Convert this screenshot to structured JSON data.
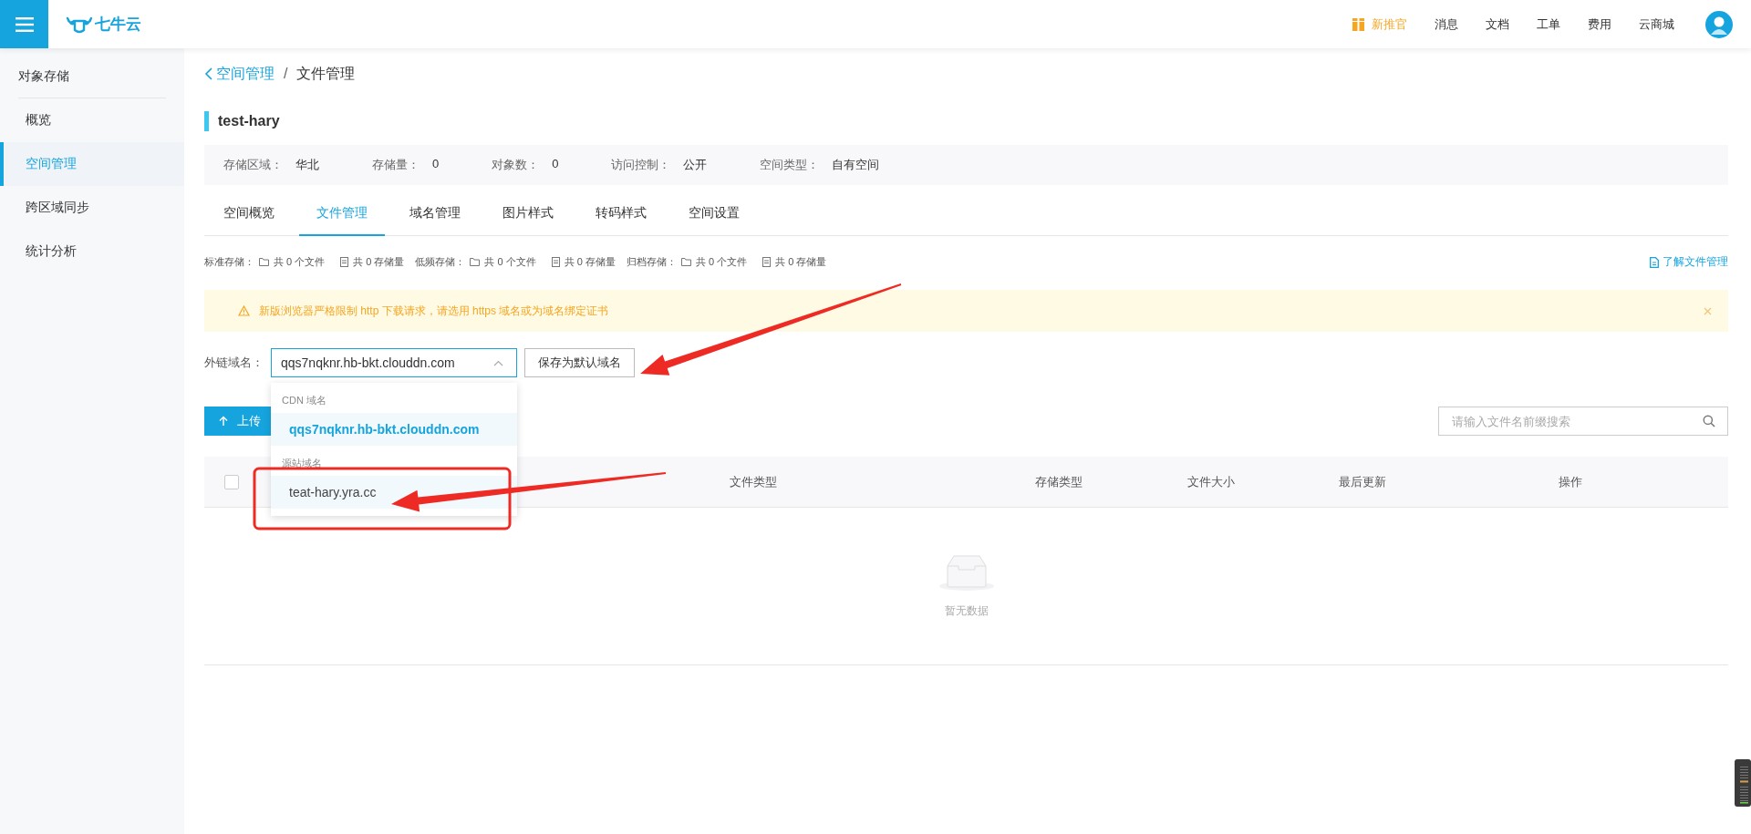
{
  "header": {
    "logo": "七牛云",
    "nav": [
      {
        "label": "新推官",
        "kind": "promo"
      },
      {
        "label": "消息",
        "kind": "link"
      },
      {
        "label": "文档",
        "kind": "link"
      },
      {
        "label": "工单",
        "kind": "link"
      },
      {
        "label": "费用",
        "kind": "link"
      },
      {
        "label": "云商城",
        "kind": "link"
      }
    ]
  },
  "sidebar": {
    "title": "对象存储",
    "items": [
      {
        "label": "概览",
        "selected": false
      },
      {
        "label": "空间管理",
        "selected": true
      },
      {
        "label": "跨区域同步",
        "selected": false
      },
      {
        "label": "统计分析",
        "selected": false
      }
    ]
  },
  "breadcrumb": {
    "back": "空间管理",
    "separator": "/",
    "current": "文件管理"
  },
  "bucket": {
    "title": "test-hary",
    "info": [
      {
        "label": "存储区域：",
        "value": "华北"
      },
      {
        "label": "存储量：",
        "value": "0"
      },
      {
        "label": "对象数：",
        "value": "0"
      },
      {
        "label": "访问控制：",
        "value": "公开"
      },
      {
        "label": "空间类型：",
        "value": "自有空间"
      }
    ]
  },
  "tabs": [
    {
      "label": "空间概览",
      "selected": false
    },
    {
      "label": "文件管理",
      "selected": true
    },
    {
      "label": "域名管理",
      "selected": false
    },
    {
      "label": "图片样式",
      "selected": false
    },
    {
      "label": "转码样式",
      "selected": false
    },
    {
      "label": "空间设置",
      "selected": false
    }
  ],
  "stats": {
    "groups": [
      {
        "label": "标准存储：",
        "files": "共 0 个文件",
        "size": "共 0 存储量"
      },
      {
        "label": "低频存储：",
        "files": "共 0 个文件",
        "size": "共 0 存储量"
      },
      {
        "label": "归档存储：",
        "files": "共 0 个文件",
        "size": "共 0 存储量"
      }
    ],
    "help_link": "了解文件管理"
  },
  "alert": {
    "text": "新版浏览器严格限制 http 下载请求，请选用 https 域名或为域名绑定证书"
  },
  "domain": {
    "label": "外链域名：",
    "value": "qqs7nqknr.hb-bkt.clouddn.com",
    "save_button": "保存为默认域名",
    "dropdown": {
      "expanded": true,
      "groups": [
        {
          "title": "CDN 域名",
          "options": [
            {
              "label": "qqs7nqknr.hb-bkt.clouddn.com",
              "selected": true
            }
          ]
        },
        {
          "title": "源站域名",
          "options": [
            {
              "label": "teat-hary.yra.cc",
              "selected": false
            }
          ]
        }
      ]
    }
  },
  "upload_button": "上传",
  "search": {
    "placeholder": "请输入文件名前缀搜索"
  },
  "table": {
    "select_all": {
      "checked": false
    },
    "columns": [
      "文件类型",
      "存储类型",
      "文件大小",
      "最后更新",
      "操作"
    ],
    "empty_text": "暂无数据"
  }
}
